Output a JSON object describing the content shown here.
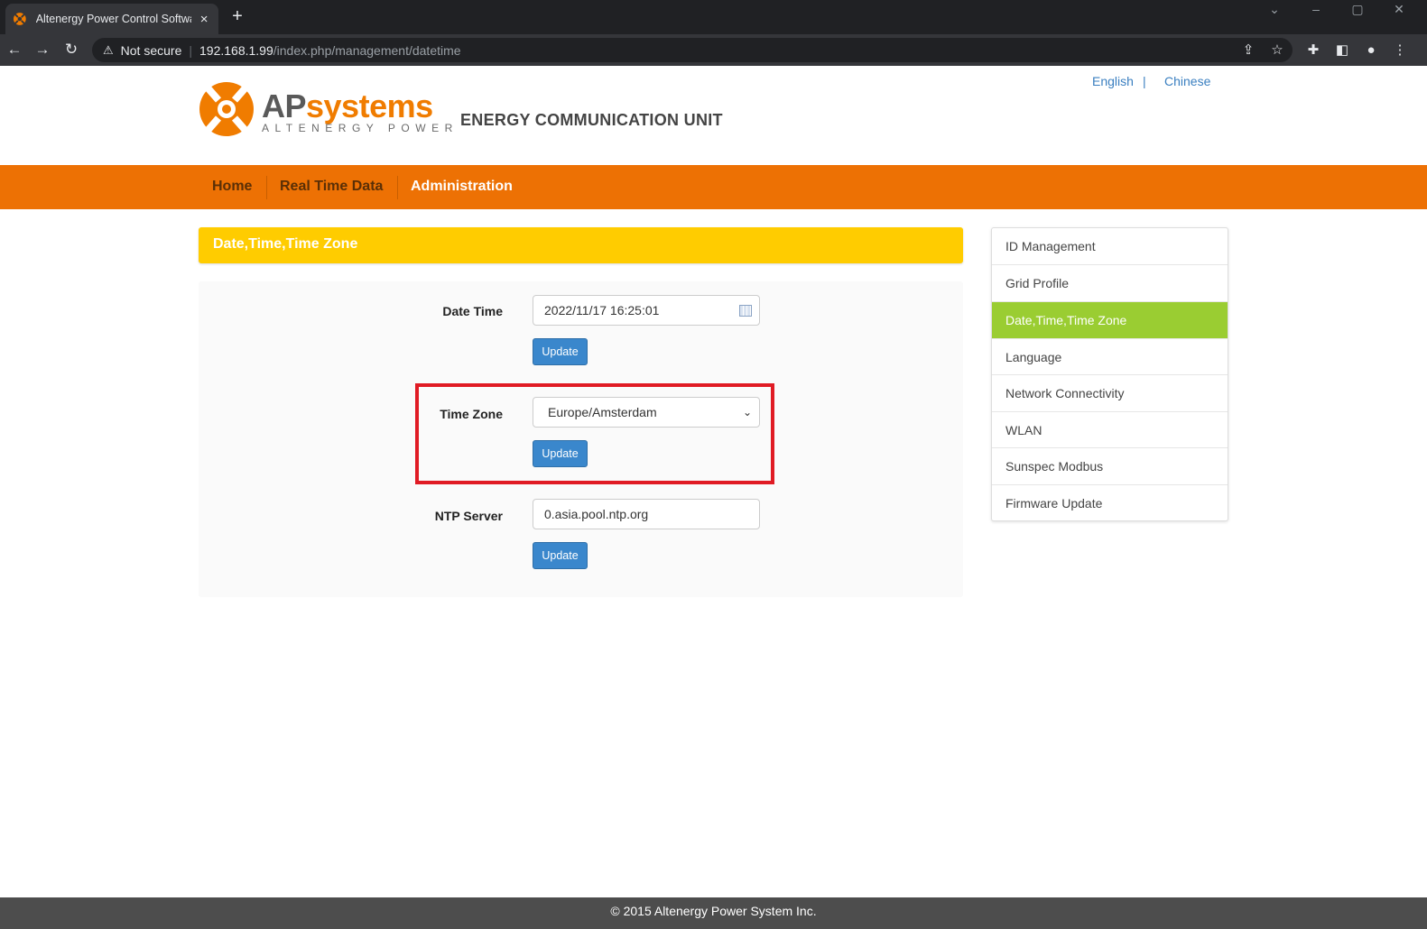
{
  "browser": {
    "tab_title": "Altenergy Power Control Software",
    "tab_close": "×",
    "new_tab": "+",
    "security_label": "Not secure",
    "url_host": "192.168.1.99",
    "url_path": "/index.php/management/datetime"
  },
  "header": {
    "logo_primary": "AP",
    "logo_secondary": "systems",
    "logo_subtitle": "ALTENERGY POWER",
    "title": "ENERGY COMMUNICATION UNIT",
    "languages": [
      "English",
      "Chinese"
    ],
    "language_separator": "|"
  },
  "nav": {
    "items": [
      {
        "label": "Home"
      },
      {
        "label": "Real Time Data"
      },
      {
        "label": "Administration"
      }
    ],
    "active": "Administration"
  },
  "section": {
    "title": "Date,Time,Time Zone"
  },
  "form": {
    "date_time": {
      "label": "Date Time",
      "value": "2022/11/17 16:25:01",
      "button": "Update"
    },
    "time_zone": {
      "label": "Time Zone",
      "value": "Europe/Amsterdam",
      "button": "Update"
    },
    "ntp_server": {
      "label": "NTP Server",
      "value": "0.asia.pool.ntp.org",
      "button": "Update"
    }
  },
  "sidebar": {
    "items": [
      {
        "label": "ID Management"
      },
      {
        "label": "Grid Profile"
      },
      {
        "label": "Date,Time,Time Zone"
      },
      {
        "label": "Language"
      },
      {
        "label": "Network Connectivity"
      },
      {
        "label": "WLAN"
      },
      {
        "label": "Sunspec Modbus"
      },
      {
        "label": "Firmware Update"
      }
    ],
    "active": "Date,Time,Time Zone"
  },
  "footer": {
    "text": "© 2015 Altenergy Power System Inc."
  },
  "colors": {
    "brand_orange": "#ed7104",
    "header_yellow": "#ffcc00",
    "active_green": "#9acd32",
    "button_blue": "#3a87cc",
    "highlight_red": "#e01b24"
  },
  "icons": {
    "back": "arrow-left-icon",
    "forward": "arrow-right-icon",
    "reload": "reload-icon",
    "warning": "warning-icon",
    "share": "share-icon",
    "bookmark": "star-icon",
    "extensions": "puzzle-icon",
    "sidepanel": "side-panel-icon",
    "profile": "profile-icon",
    "menu": "kebab-menu-icon",
    "calendar": "calendar-icon",
    "dropdown": "chevron-down-icon"
  }
}
